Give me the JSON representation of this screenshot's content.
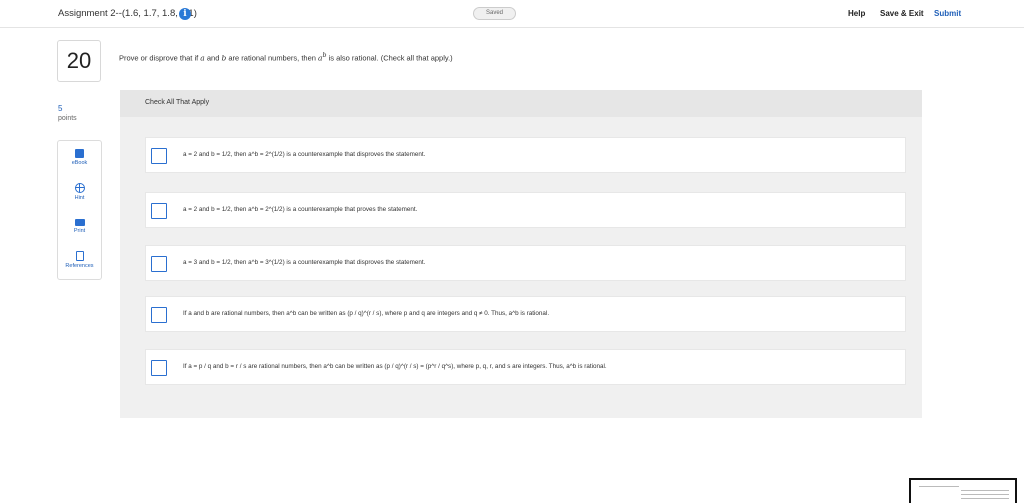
{
  "header": {
    "assignment_title": "Assignment 2--(1.6, 1.7, 1.8, 2.1)",
    "info_icon": "i",
    "status": "Saved",
    "help_label": "Help",
    "save_exit_label": "Save & Exit",
    "submit_label": "Submit"
  },
  "question": {
    "number": "20",
    "points_value": "5",
    "points_label": "points",
    "prompt_pre": "Prove or disprove that if ",
    "prompt_a": "a",
    "prompt_and": " and ",
    "prompt_b": "b",
    "prompt_mid": " are rational numbers, then ",
    "prompt_ab": "a",
    "prompt_ab_sup": "b",
    "prompt_post": " is also rational. (Check all that apply.)"
  },
  "tools": {
    "ebook": {
      "label": "eBook",
      "icon": "book-icon"
    },
    "hint": {
      "label": "Hint",
      "icon": "lifebuoy-icon"
    },
    "print": {
      "label": "Print",
      "icon": "printer-icon"
    },
    "references": {
      "label": "References",
      "icon": "reference-icon"
    }
  },
  "answers": {
    "instruction": "Check All That Apply",
    "options": [
      {
        "text": "a = 2 and b = 1/2, then a^b = 2^(1/2) is a counterexample that disproves the statement.",
        "checked": false
      },
      {
        "text": "a = 2 and b = 1/2, then a^b = 2^(1/2) is a counterexample that proves the statement.",
        "checked": false
      },
      {
        "text": "a = 3 and b = 1/2, then a^b = 3^(1/2) is a counterexample that disproves the statement.",
        "checked": false
      },
      {
        "text": "If a and b are rational numbers, then a^b can be written as (p / q)^(r / s), where p and q are integers and q ≠ 0. Thus, a^b is rational.",
        "checked": false
      },
      {
        "text": "If a = p / q and b = r / s are rational numbers, then a^b can be written as (p / q)^(r / s) = (p^r / q^s), where p, q, r, and s are integers. Thus, a^b is rational.",
        "checked": false
      }
    ]
  },
  "colors": {
    "accent": "#2a6fd0",
    "submit": "#1f5fb8",
    "panel_bg": "#f0f0f0"
  }
}
